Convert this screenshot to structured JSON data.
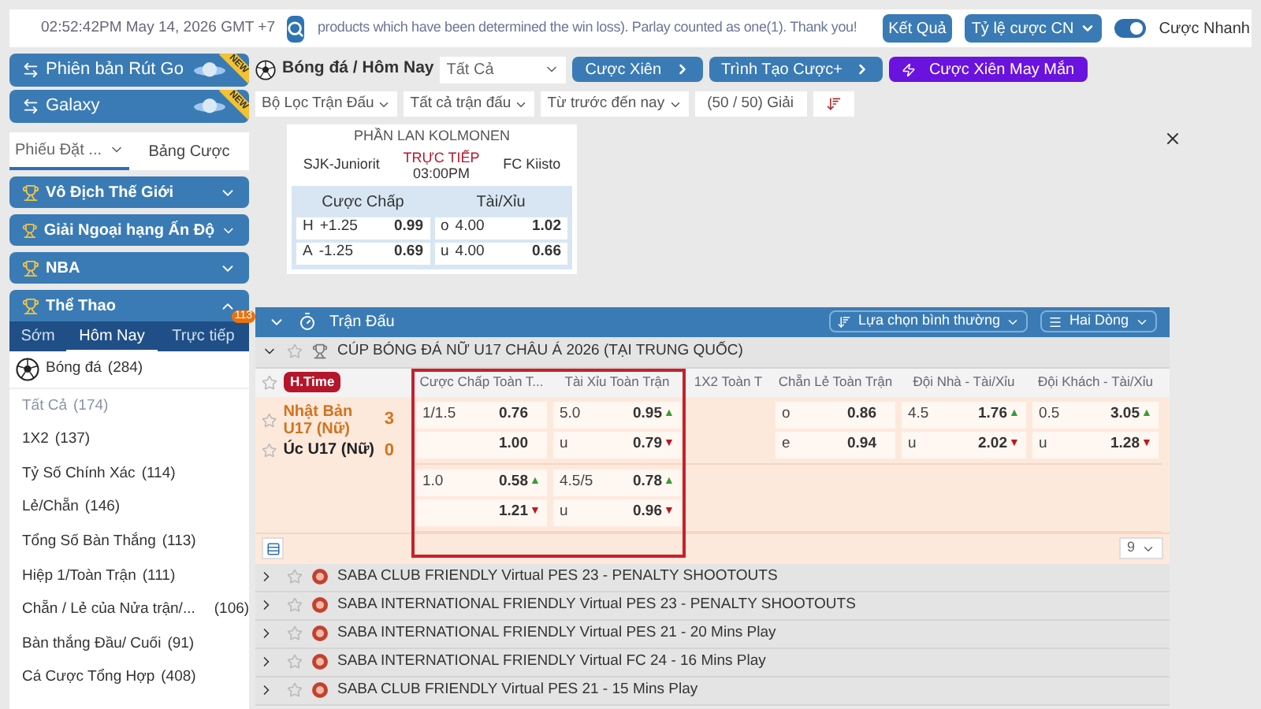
{
  "top_bar": {
    "datetime": "02:52:42PM May 14, 2026 GMT +7",
    "ticker": "products which have been determined the win loss). Parlay counted as one(1). Thank you!",
    "results_button": "Kết Quả",
    "odds_dropdown": "Tỷ lệ cược CN",
    "quick_bet": {
      "label": "Cược Nhanh",
      "on": true
    }
  },
  "sidebar": {
    "banners": [
      {
        "label": "Phiên bản Rút Go",
        "badge": "NEW"
      },
      {
        "label": "Galaxy",
        "badge": "NEW"
      }
    ],
    "bet_tabs": [
      {
        "label": "Phiếu Đặt ...",
        "selected": true
      },
      {
        "label": "Bảng Cược",
        "selected": false
      }
    ],
    "menus": [
      {
        "label": "Vô Địch Thế Giới",
        "expanded": false
      },
      {
        "label": "Giải Ngoại hạng Ấn Độ",
        "expanded": false
      },
      {
        "label": "NBA",
        "expanded": false
      },
      {
        "label": "Thể Thao",
        "expanded": true
      }
    ],
    "sport_tabs": [
      {
        "label": "Sớm",
        "selected": false
      },
      {
        "label": "Hôm Nay",
        "selected": true
      },
      {
        "label": "Trực tiếp",
        "selected": false,
        "badge": "113"
      }
    ],
    "sport": {
      "label": "Bóng đá",
      "count": "(284)"
    },
    "markets": [
      {
        "label": "Tất Cả",
        "count": "(174)",
        "selected": true
      },
      {
        "label": "1X2",
        "count": "(137)",
        "selected": false
      },
      {
        "label": "Tỷ Số Chính Xác",
        "count": "(114)",
        "selected": false
      },
      {
        "label": "Lẻ/Chẵn",
        "count": "(146)",
        "selected": false
      },
      {
        "label": "Tổng Số Bàn Thắng",
        "count": "(113)",
        "selected": false
      },
      {
        "label": "Hiệp 1/Toàn Trận",
        "count": "(111)",
        "selected": false
      },
      {
        "label": "Chẵn / Lẻ của Nửa trận/...",
        "count": "(106)",
        "selected": false
      },
      {
        "label": "Bàn thắng Đầu/ Cuối",
        "count": "(91)",
        "selected": false
      },
      {
        "label": "Cá Cược Tổng Hợp",
        "count": "(408)",
        "selected": false
      }
    ]
  },
  "main": {
    "breadcrumb": "Bóng đá / Hôm Nay",
    "filter_select": "Tất Cả",
    "action_buttons": [
      {
        "label": "Cược Xiên",
        "kind": "nav"
      },
      {
        "label": "Trình Tạo Cược+",
        "kind": "nav"
      },
      {
        "label": "Cược Xiên May Mắn",
        "kind": "lucky"
      }
    ],
    "filters": [
      "Bộ Lọc Trận Đấu",
      "Tất cả trận đấu",
      "Từ trước đến nay"
    ],
    "league_count": "(50 / 50) Giải",
    "featured": {
      "league": "PHẦN LAN KOLMONEN",
      "home": "SJK-Juniorit",
      "status": "TRỰC TIẾP",
      "time": "03:00PM",
      "away": "FC Kiisto",
      "markets": [
        {
          "title": "Cược Chấp",
          "rows": [
            {
              "side": "H",
              "line": "+1.25",
              "odds": "0.99"
            },
            {
              "side": "A",
              "line": "-1.25",
              "odds": "0.69"
            }
          ]
        },
        {
          "title": "Tài/Xỉu",
          "rows": [
            {
              "side": "o",
              "line": "4.00",
              "odds": "1.02"
            },
            {
              "side": "u",
              "line": "4.00",
              "odds": "0.66"
            }
          ]
        }
      ]
    },
    "panel": {
      "title": "Trận Đấu",
      "sort": "Lựa chọn bình thường",
      "view": "Hai Dòng"
    },
    "league": {
      "name": "CÚP BÓNG ĐÁ NỮ U17 CHÂU Á 2026 (TẠI TRUNG QUỐC)",
      "expanded": true
    },
    "columns": [
      "Cược Chấp Toàn T...",
      "Tài Xỉu Toàn Trận",
      "1X2 Toàn T",
      "Chẵn Lẻ Toàn Trận",
      "Đội Nhà - Tài/Xỉu",
      "Đội Khách - Tài/Xỉu"
    ],
    "match": {
      "status": "H.Time",
      "home": {
        "name": "Nhật Bản U17 (Nữ)",
        "score": "3"
      },
      "away": {
        "name": "Úc U17 (Nữ)",
        "score": "0"
      },
      "lines": [
        {
          "cells": [
            [
              {
                "label": "1/1.5",
                "odds": "0.76"
              },
              {
                "odds": "1.00"
              }
            ],
            [
              {
                "label": "5.0",
                "odds": "0.95",
                "kind": "up",
                "arrow": "▲"
              },
              {
                "label": "u",
                "odds": "0.79",
                "kind": "down",
                "arrow": "▼"
              }
            ],
            [],
            [
              {
                "label": "o",
                "odds": "0.86"
              },
              {
                "label": "e",
                "odds": "0.94"
              }
            ],
            [
              {
                "label": "4.5",
                "odds": "1.76",
                "kind": "up",
                "arrow": "▲"
              },
              {
                "label": "u",
                "odds": "2.02",
                "kind": "down",
                "arrow": "▼"
              }
            ],
            [
              {
                "label": "0.5",
                "odds": "3.05",
                "kind": "up",
                "arrow": "▲"
              },
              {
                "label": "u",
                "odds": "1.28",
                "kind": "down",
                "arrow": "▼"
              }
            ]
          ]
        },
        {
          "cells": [
            [
              {
                "label": "1.0",
                "odds": "0.58",
                "kind": "up",
                "arrow": "▲"
              },
              {
                "odds": "1.21",
                "kind": "down",
                "arrow": "▼"
              }
            ],
            [
              {
                "label": "4.5/5",
                "odds": "0.78",
                "kind": "up",
                "arrow": "▲"
              },
              {
                "label": "u",
                "odds": "0.96",
                "kind": "down",
                "arrow": "▼"
              }
            ]
          ]
        }
      ]
    },
    "page_size": "9",
    "other_leagues": [
      {
        "name": "SABA CLUB FRIENDLY Virtual PES 23 - PENALTY SHOOTOUTS"
      },
      {
        "name": "SABA INTERNATIONAL FRIENDLY Virtual PES 23 - PENALTY SHOOTOUTS"
      },
      {
        "name": "SABA INTERNATIONAL FRIENDLY Virtual PES 21 - 20 Mins Play"
      },
      {
        "name": "SABA INTERNATIONAL FRIENDLY Virtual FC 24 - 16 Mins Play"
      },
      {
        "name": "SABA CLUB FRIENDLY Virtual PES 21 - 15 Mins Play"
      }
    ]
  }
}
